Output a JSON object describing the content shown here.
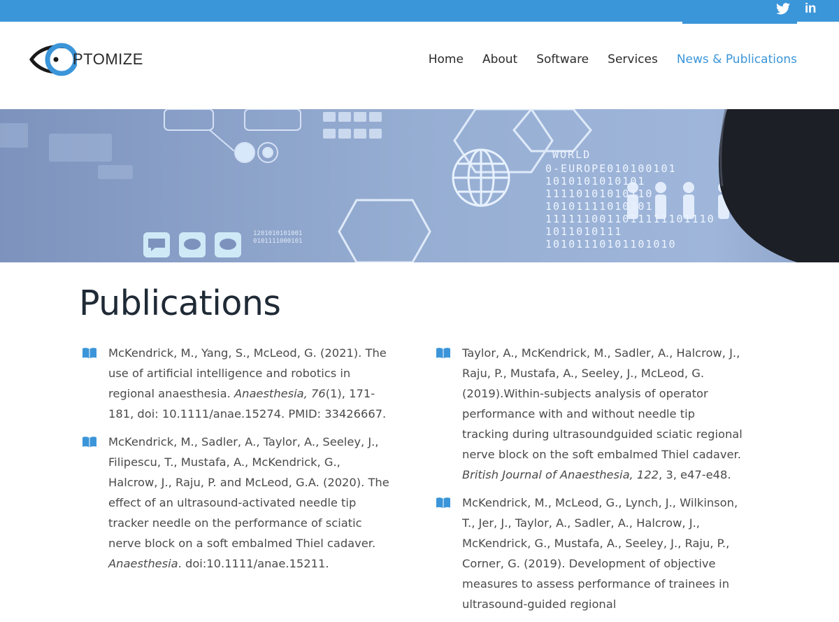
{
  "brand": {
    "logo_text": "PTOMIZE"
  },
  "social": {
    "linkedin_label": "in"
  },
  "nav": {
    "items": [
      {
        "label": "Home",
        "active": false
      },
      {
        "label": "About",
        "active": false
      },
      {
        "label": "Software",
        "active": false
      },
      {
        "label": "Services",
        "active": false
      },
      {
        "label": "News & Publications",
        "active": true
      }
    ]
  },
  "banner": {
    "binary_rows": [
      "1201010101001",
      "0101111000101",
      "0-EUROPE010100101",
      "1010101010101",
      "11110101010110",
      "10101111010101",
      "1111110011011111101110",
      "1011010111",
      "10101110101101010"
    ],
    "world_label": "WORLD"
  },
  "page": {
    "title": "Publications"
  },
  "publications": {
    "left": [
      {
        "pre": "McKendrick, M., Yang, S., McLeod, G. (2021). The use of artificial intelligence and robotics in regional anaesthesia. ",
        "journal": "Anaesthesia, 76",
        "post": "(1), 171-181, doi: 10.1111/anae.15274. PMID: 33426667."
      },
      {
        "pre": "McKendrick, M., Sadler, A., Taylor, A., Seeley, J., Filipescu, T., Mustafa, A., McKendrick, G., Halcrow, J., Raju, P. and McLeod, G.A. (2020). The effect of an ultrasound-activated needle tip tracker needle on the performance of sciatic nerve block on a soft embalmed Thiel cadaver. ",
        "journal": "Anaesthesia",
        "post": ". doi:10.1111/anae.15211."
      }
    ],
    "right": [
      {
        "pre": "Taylor, A., McKendrick, M., Sadler, A., Halcrow, J., Raju, P., Mustafa, A., Seeley, J., McLeod, G. (2019).Within-subjects analysis of operator performance with and without needle tip tracking during ultrasoundguided sciatic regional nerve block on the soft embalmed Thiel cadaver. ",
        "journal": "British Journal of Anaesthesia, 122",
        "post": ", 3, e47-e48."
      },
      {
        "pre": "McKendrick, M., McLeod, G., Lynch, J., Wilkinson, T., Jer, J., Taylor, A., Sadler, A., Halcrow, J., McKendrick, G., Mustafa, A., Seeley, J., Raju, P., Corner, G. (2019). Development of objective measures to assess performance of trainees in ultrasound-guided regional",
        "journal": "",
        "post": ""
      }
    ]
  },
  "icons": {
    "twitter": "twitter-icon",
    "linkedin": "linkedin-icon",
    "book": "book-icon"
  },
  "colors": {
    "accent": "#3b95d9",
    "title": "#1f2a36",
    "body_text": "#4a4a4a",
    "banner": "#8ea3c9"
  }
}
